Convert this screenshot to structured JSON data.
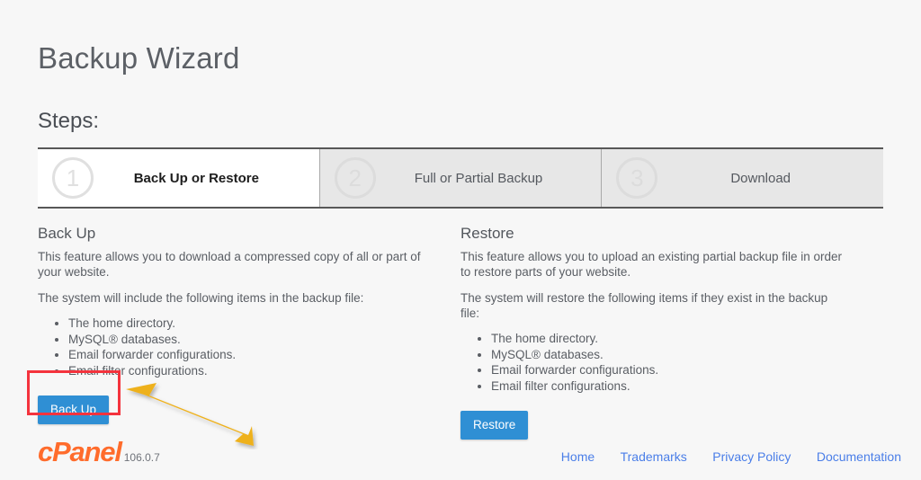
{
  "page": {
    "title": "Backup Wizard",
    "steps_heading": "Steps:"
  },
  "steps": [
    {
      "number": "①",
      "num_plain": "1",
      "label": "Back Up or Restore",
      "active": true
    },
    {
      "number": "②",
      "num_plain": "2",
      "label": "Full or Partial Backup",
      "active": false
    },
    {
      "number": "③",
      "num_plain": "3",
      "label": "Download",
      "active": false
    }
  ],
  "backup": {
    "title": "Back Up",
    "description": "This feature allows you to download a compressed copy of all or part of your website.",
    "list_intro": "The system will include the following items in the backup file:",
    "items": [
      "The home directory.",
      "MySQL® databases.",
      "Email forwarder configurations.",
      "Email filter configurations."
    ],
    "button_label": "Back Up"
  },
  "restore": {
    "title": "Restore",
    "description": "This feature allows you to upload an existing partial backup file in order to restore parts of your website.",
    "list_intro": "The system will restore the following items if they exist in the backup file:",
    "items": [
      "The home directory.",
      "MySQL® databases.",
      "Email forwarder configurations.",
      "Email filter configurations."
    ],
    "button_label": "Restore"
  },
  "footer": {
    "brand": "cPanel",
    "version": "106.0.7",
    "links": [
      {
        "label": "Home"
      },
      {
        "label": "Trademarks"
      },
      {
        "label": "Privacy Policy"
      },
      {
        "label": "Documentation"
      }
    ]
  },
  "annotations": {
    "highlight_color": "#f4333d",
    "arrow_color": "#eeb11e",
    "highlight_target": "Back Up",
    "arrow_points_to": "Back Up"
  },
  "colors": {
    "background": "#f7f7f7",
    "button_blue": "#2f8fd4",
    "brand_orange": "#ff6c2c",
    "link_blue": "#4a7ee8",
    "step_inactive_bg": "#e7e7e7",
    "step_active_bg": "#ffffff"
  }
}
